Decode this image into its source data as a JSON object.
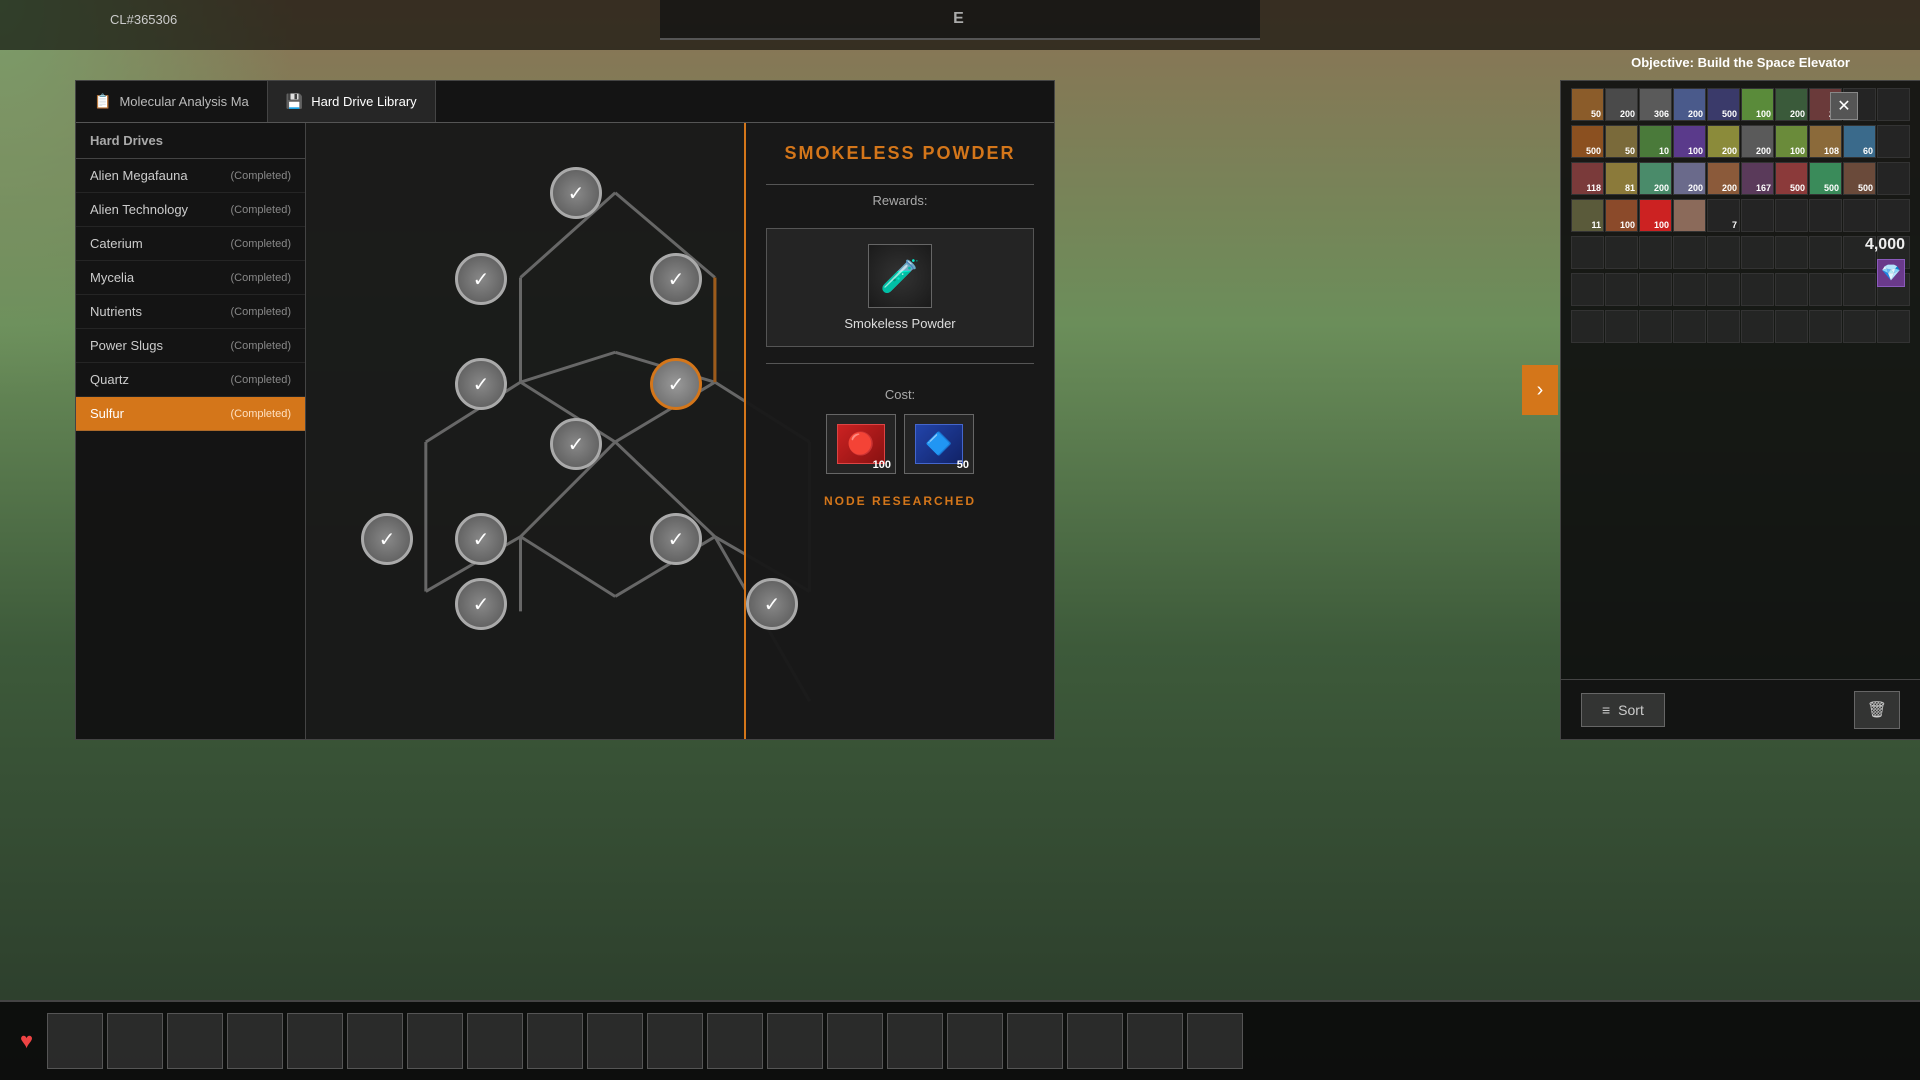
{
  "hud": {
    "cl_code": "CL#365306",
    "objective_label": "Objective:",
    "objective_value": "Build the Space Elevator",
    "e_marker": "E"
  },
  "tabs": [
    {
      "id": "molecular",
      "label": "Molecular Analysis Ma",
      "icon": "📋",
      "active": false
    },
    {
      "id": "harddrive",
      "label": "Hard Drive Library",
      "icon": "💾",
      "active": true
    }
  ],
  "sidebar": {
    "header": "Hard Drives",
    "items": [
      {
        "id": "alien-megafauna",
        "label": "Alien Megafauna",
        "status": "(Completed)",
        "active": false
      },
      {
        "id": "alien-technology",
        "label": "Alien Technology",
        "status": "(Completed)",
        "active": false
      },
      {
        "id": "caterium",
        "label": "Caterium",
        "status": "(Completed)",
        "active": false
      },
      {
        "id": "mycelia",
        "label": "Mycelia",
        "status": "(Completed)",
        "active": false
      },
      {
        "id": "nutrients",
        "label": "Nutrients",
        "status": "(Completed)",
        "active": false
      },
      {
        "id": "power-slugs",
        "label": "Power Slugs",
        "status": "(Completed)",
        "active": false
      },
      {
        "id": "quartz",
        "label": "Quartz",
        "status": "(Completed)",
        "active": false
      },
      {
        "id": "sulfur",
        "label": "Sulfur",
        "status": "(Completed)",
        "active": true
      }
    ]
  },
  "detail": {
    "title": "SMOKELESS POWDER",
    "rewards_label": "Rewards:",
    "reward_name": "Smokeless Powder",
    "cost_label": "Cost:",
    "cost_items": [
      {
        "icon": "🔴",
        "count": "100"
      },
      {
        "icon": "🔵",
        "count": "50"
      }
    ],
    "node_status": "NODE RESEARCHED"
  },
  "inventory": {
    "currency": "4,000",
    "sort_label": "Sort",
    "rows": [
      [
        {
          "color": "#8B5c2a",
          "count": "50"
        },
        {
          "color": "#4a4a4a",
          "count": "200"
        },
        {
          "color": "#5a5a5a",
          "count": "306"
        },
        {
          "color": "#4a5a8B",
          "count": "200"
        },
        {
          "color": "#3a3a6a",
          "count": "500"
        },
        {
          "color": "#5a8B3a",
          "count": "100"
        },
        {
          "color": "#3a5a3a",
          "count": "200"
        },
        {
          "color": "#6a3a3a",
          "count": "20"
        },
        {
          "color": "transparent",
          "count": ""
        },
        {
          "color": "transparent",
          "count": ""
        }
      ],
      [
        {
          "color": "#8B5020",
          "count": "500"
        },
        {
          "color": "#7a6a3a",
          "count": "50"
        },
        {
          "color": "#4a7a3a",
          "count": "10"
        },
        {
          "color": "#5a3a8B",
          "count": "100"
        },
        {
          "color": "#8B8B3a",
          "count": "200"
        },
        {
          "color": "#5a5a5a",
          "count": "200"
        },
        {
          "color": "#6a8B3a",
          "count": "100"
        },
        {
          "color": "#8B6a3a",
          "count": "108"
        },
        {
          "color": "#3a6a8B",
          "count": "60"
        },
        {
          "color": "transparent",
          "count": ""
        }
      ],
      [
        {
          "color": "#7a3a3a",
          "count": "118"
        },
        {
          "color": "#8B7a3a",
          "count": "81"
        },
        {
          "color": "#4a8B6a",
          "count": "200"
        },
        {
          "color": "#6a6a8B",
          "count": "200"
        },
        {
          "color": "#8B5a3a",
          "count": "200"
        },
        {
          "color": "#5a3a5a",
          "count": "167"
        },
        {
          "color": "#8B3a3a",
          "count": "500"
        },
        {
          "color": "#3a8B5a",
          "count": "500"
        },
        {
          "color": "#6a4a3a",
          "count": "500"
        },
        {
          "color": "transparent",
          "count": ""
        }
      ],
      [
        {
          "color": "#5a5a3a",
          "count": "11"
        },
        {
          "color": "#8B4a2a",
          "count": "100"
        },
        {
          "color": "#cc2222",
          "count": "100"
        },
        {
          "color": "#8B6a5a",
          "count": ""
        },
        {
          "color": "transparent",
          "count": "7"
        },
        {
          "color": "transparent",
          "count": ""
        },
        {
          "color": "transparent",
          "count": ""
        },
        {
          "color": "transparent",
          "count": ""
        },
        {
          "color": "transparent",
          "count": ""
        },
        {
          "color": "transparent",
          "count": ""
        }
      ]
    ]
  },
  "buttons": {
    "close": "✕",
    "sort_icon": "≡",
    "delete_icon": "🗑",
    "nav_arrow": "›"
  }
}
